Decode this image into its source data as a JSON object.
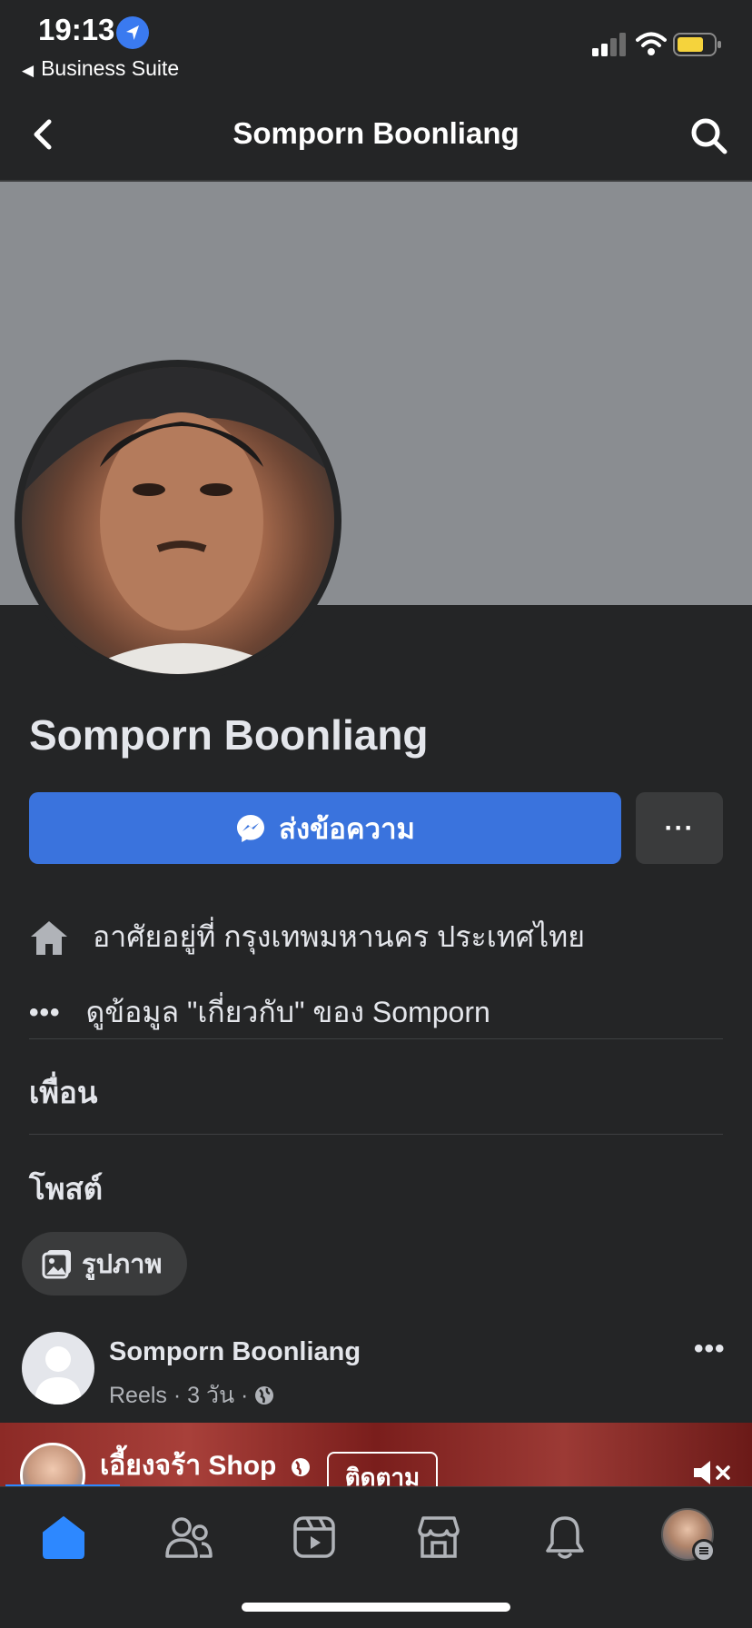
{
  "status_bar": {
    "time": "19:13",
    "back_app": "Business Suite",
    "icons": [
      "location-arrow-icon",
      "cellular-signal-icon",
      "wifi-icon",
      "battery-icon"
    ]
  },
  "header": {
    "title": "Somporn Boonliang",
    "back_icon": "chevron-left-icon",
    "search_icon": "search-icon"
  },
  "profile": {
    "name": "Somporn Boonliang",
    "cover_color": "#8a8d91"
  },
  "actions": {
    "message_label": "ส่งข้อความ",
    "more_label": "···",
    "accent": "#3a73dd"
  },
  "info": {
    "lives_in": "อาศัยอยู่ที่ กรุงเทพมหานคร ประเทศไทย",
    "see_about": "ดูข้อมูล \"เกี่ยวกับ\" ของ Somporn"
  },
  "sections": {
    "friends": "เพื่อน",
    "posts": "โพสต์",
    "photos_chip": "รูปภาพ"
  },
  "post": {
    "author": "Somporn Boonliang",
    "meta": "Reels · 3 วัน ·",
    "privacy_icon": "globe-icon",
    "more": "•••",
    "reel": {
      "page_name": "เอี้ยงจร้า Shop",
      "follow_label": "ติดตาม",
      "mute_icon": "speaker-muted-icon"
    }
  },
  "tab_bar": {
    "tabs": [
      "home-icon",
      "friends-icon",
      "video-icon",
      "marketplace-icon",
      "bell-icon",
      "profile-icon"
    ],
    "active": "home-icon",
    "active_color": "#2d88ff"
  }
}
